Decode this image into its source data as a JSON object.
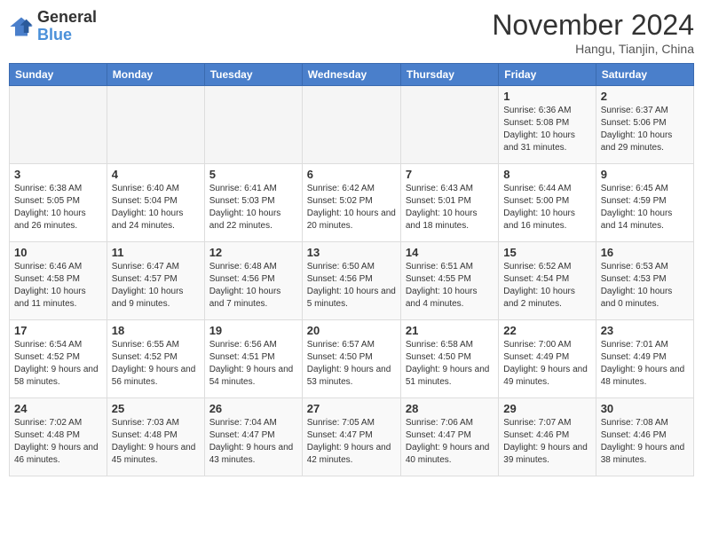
{
  "header": {
    "logo": {
      "line1": "General",
      "line2": "Blue"
    },
    "title": "November 2024",
    "location": "Hangu, Tianjin, China"
  },
  "weekdays": [
    "Sunday",
    "Monday",
    "Tuesday",
    "Wednesday",
    "Thursday",
    "Friday",
    "Saturday"
  ],
  "weeks": [
    [
      {
        "day": "",
        "info": ""
      },
      {
        "day": "",
        "info": ""
      },
      {
        "day": "",
        "info": ""
      },
      {
        "day": "",
        "info": ""
      },
      {
        "day": "",
        "info": ""
      },
      {
        "day": "1",
        "info": "Sunrise: 6:36 AM\nSunset: 5:08 PM\nDaylight: 10 hours and 31 minutes."
      },
      {
        "day": "2",
        "info": "Sunrise: 6:37 AM\nSunset: 5:06 PM\nDaylight: 10 hours and 29 minutes."
      }
    ],
    [
      {
        "day": "3",
        "info": "Sunrise: 6:38 AM\nSunset: 5:05 PM\nDaylight: 10 hours and 26 minutes."
      },
      {
        "day": "4",
        "info": "Sunrise: 6:40 AM\nSunset: 5:04 PM\nDaylight: 10 hours and 24 minutes."
      },
      {
        "day": "5",
        "info": "Sunrise: 6:41 AM\nSunset: 5:03 PM\nDaylight: 10 hours and 22 minutes."
      },
      {
        "day": "6",
        "info": "Sunrise: 6:42 AM\nSunset: 5:02 PM\nDaylight: 10 hours and 20 minutes."
      },
      {
        "day": "7",
        "info": "Sunrise: 6:43 AM\nSunset: 5:01 PM\nDaylight: 10 hours and 18 minutes."
      },
      {
        "day": "8",
        "info": "Sunrise: 6:44 AM\nSunset: 5:00 PM\nDaylight: 10 hours and 16 minutes."
      },
      {
        "day": "9",
        "info": "Sunrise: 6:45 AM\nSunset: 4:59 PM\nDaylight: 10 hours and 14 minutes."
      }
    ],
    [
      {
        "day": "10",
        "info": "Sunrise: 6:46 AM\nSunset: 4:58 PM\nDaylight: 10 hours and 11 minutes."
      },
      {
        "day": "11",
        "info": "Sunrise: 6:47 AM\nSunset: 4:57 PM\nDaylight: 10 hours and 9 minutes."
      },
      {
        "day": "12",
        "info": "Sunrise: 6:48 AM\nSunset: 4:56 PM\nDaylight: 10 hours and 7 minutes."
      },
      {
        "day": "13",
        "info": "Sunrise: 6:50 AM\nSunset: 4:56 PM\nDaylight: 10 hours and 5 minutes."
      },
      {
        "day": "14",
        "info": "Sunrise: 6:51 AM\nSunset: 4:55 PM\nDaylight: 10 hours and 4 minutes."
      },
      {
        "day": "15",
        "info": "Sunrise: 6:52 AM\nSunset: 4:54 PM\nDaylight: 10 hours and 2 minutes."
      },
      {
        "day": "16",
        "info": "Sunrise: 6:53 AM\nSunset: 4:53 PM\nDaylight: 10 hours and 0 minutes."
      }
    ],
    [
      {
        "day": "17",
        "info": "Sunrise: 6:54 AM\nSunset: 4:52 PM\nDaylight: 9 hours and 58 minutes."
      },
      {
        "day": "18",
        "info": "Sunrise: 6:55 AM\nSunset: 4:52 PM\nDaylight: 9 hours and 56 minutes."
      },
      {
        "day": "19",
        "info": "Sunrise: 6:56 AM\nSunset: 4:51 PM\nDaylight: 9 hours and 54 minutes."
      },
      {
        "day": "20",
        "info": "Sunrise: 6:57 AM\nSunset: 4:50 PM\nDaylight: 9 hours and 53 minutes."
      },
      {
        "day": "21",
        "info": "Sunrise: 6:58 AM\nSunset: 4:50 PM\nDaylight: 9 hours and 51 minutes."
      },
      {
        "day": "22",
        "info": "Sunrise: 7:00 AM\nSunset: 4:49 PM\nDaylight: 9 hours and 49 minutes."
      },
      {
        "day": "23",
        "info": "Sunrise: 7:01 AM\nSunset: 4:49 PM\nDaylight: 9 hours and 48 minutes."
      }
    ],
    [
      {
        "day": "24",
        "info": "Sunrise: 7:02 AM\nSunset: 4:48 PM\nDaylight: 9 hours and 46 minutes."
      },
      {
        "day": "25",
        "info": "Sunrise: 7:03 AM\nSunset: 4:48 PM\nDaylight: 9 hours and 45 minutes."
      },
      {
        "day": "26",
        "info": "Sunrise: 7:04 AM\nSunset: 4:47 PM\nDaylight: 9 hours and 43 minutes."
      },
      {
        "day": "27",
        "info": "Sunrise: 7:05 AM\nSunset: 4:47 PM\nDaylight: 9 hours and 42 minutes."
      },
      {
        "day": "28",
        "info": "Sunrise: 7:06 AM\nSunset: 4:47 PM\nDaylight: 9 hours and 40 minutes."
      },
      {
        "day": "29",
        "info": "Sunrise: 7:07 AM\nSunset: 4:46 PM\nDaylight: 9 hours and 39 minutes."
      },
      {
        "day": "30",
        "info": "Sunrise: 7:08 AM\nSunset: 4:46 PM\nDaylight: 9 hours and 38 minutes."
      }
    ]
  ]
}
